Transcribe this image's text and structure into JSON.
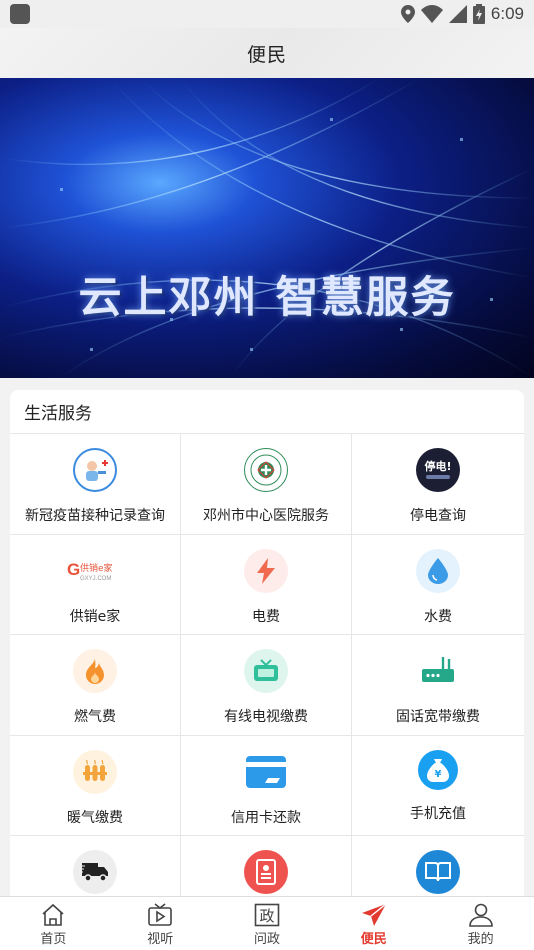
{
  "status": {
    "time": "6:09"
  },
  "header": {
    "title": "便民"
  },
  "banner": {
    "text": "云上邓州 智慧服务"
  },
  "section": {
    "title": "生活服务",
    "items": [
      {
        "label": "新冠疫苗接种记录查询",
        "icon": "vaccine-icon"
      },
      {
        "label": "邓州市中心医院服务",
        "icon": "hospital-logo-icon"
      },
      {
        "label": "停电查询",
        "icon": "power-outage-icon"
      },
      {
        "label": "供销e家",
        "icon": "gongxiao-logo-icon",
        "logo_text": "供销e家",
        "logo_sub": "GXYJ.COM"
      },
      {
        "label": "电费",
        "icon": "lightning-icon"
      },
      {
        "label": "水费",
        "icon": "water-drop-icon"
      },
      {
        "label": "燃气费",
        "icon": "flame-icon"
      },
      {
        "label": "有线电视缴费",
        "icon": "tv-icon"
      },
      {
        "label": "固话宽带缴费",
        "icon": "router-icon"
      },
      {
        "label": "暖气缴费",
        "icon": "heater-icon"
      },
      {
        "label": "信用卡还款",
        "icon": "credit-card-icon"
      },
      {
        "label": "手机充值",
        "icon": "money-bag-icon"
      },
      {
        "label": "",
        "icon": "truck-icon"
      },
      {
        "label": "",
        "icon": "document-icon"
      },
      {
        "label": "",
        "icon": "book-icon"
      }
    ]
  },
  "tabs": [
    {
      "label": "首页",
      "icon": "home-icon"
    },
    {
      "label": "视听",
      "icon": "video-icon"
    },
    {
      "label": "问政",
      "icon": "government-icon",
      "glyph": "政"
    },
    {
      "label": "便民",
      "icon": "send-icon",
      "active": true
    },
    {
      "label": "我的",
      "icon": "user-icon"
    }
  ],
  "colors": {
    "accent": "#e23a2e"
  }
}
